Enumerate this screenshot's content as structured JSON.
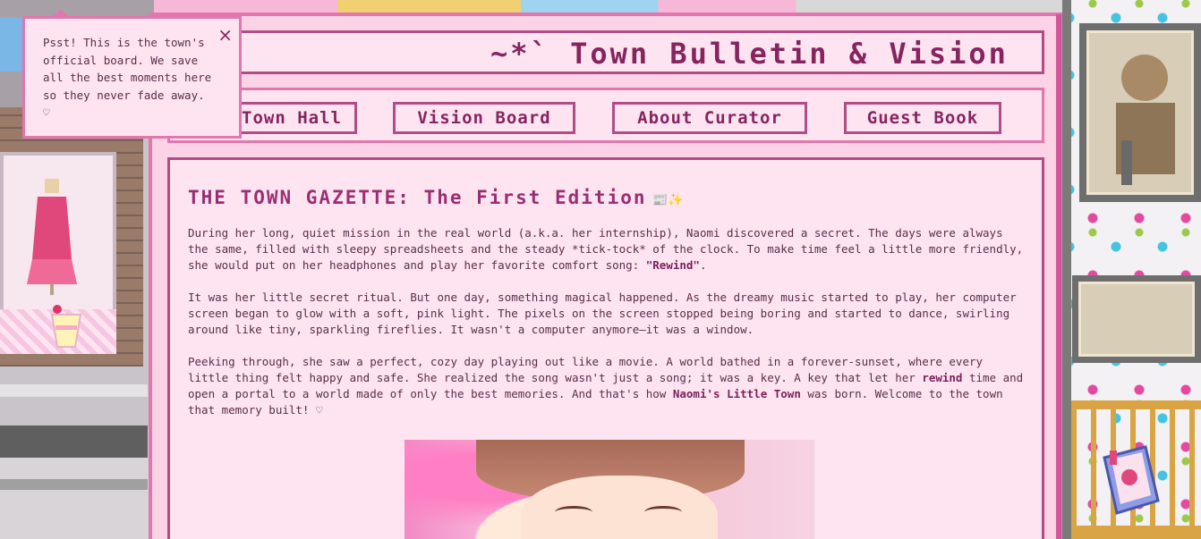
{
  "board": {
    "title": "~*` Town Bulletin & Vision"
  },
  "nav": [
    {
      "label": "Town Hall"
    },
    {
      "label": "Vision Board"
    },
    {
      "label": "About Curator"
    },
    {
      "label": "Guest Book"
    }
  ],
  "gazette": {
    "title": "THE TOWN GAZETTE: The First Edition",
    "title_emoji": "📰✨",
    "p1_a": "During her long, quiet mission in the real world (a.k.a. her internship), Naomi discovered a secret. The days were always the same, filled with sleepy spreadsheets and the steady *tick-tock* of the clock. To make time feel a little more friendly, she would put on her headphones and play her favorite comfort song: ",
    "p1_song": "\"Rewind\"",
    "p1_end": ".",
    "p2": "It was her little secret ritual. But one day, something magical happened. As the dreamy music started to play, her computer screen began to glow with a soft, pink light. The pixels on the screen stopped being boring and started to dance, swirling around like tiny, sparkling fireflies. It wasn't a computer anymore—it was a window.",
    "p3_a": "Peeking through, she saw a perfect, cozy day playing out like a movie. A world bathed in a forever-sunset, where every little thing felt happy and safe. She realized the song wasn't just a song; it was a key. A key that let her ",
    "p3_rewind": "rewind",
    "p3_b": " time and open a portal to a world made of only the best memories. And that's how ",
    "p3_town": "Naomi's Little Town",
    "p3_c": " was born. Welcome to the town that memory built! ♡"
  },
  "tooltip": {
    "text": "Psst! This is the town's official board. We save all the best moments here so they never fade away. ♡",
    "close": "×"
  },
  "colors": {
    "board_bg": "#fcd3e6",
    "accent": "#b04d86",
    "title_text": "#86245f"
  }
}
